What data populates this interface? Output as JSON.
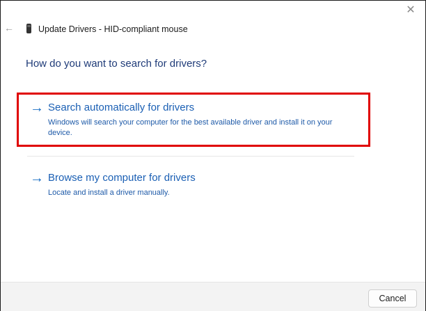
{
  "window": {
    "title": "Update Drivers - HID-compliant mouse",
    "close_glyph": "✕",
    "back_glyph": "←",
    "icons": [
      "close-icon",
      "back-arrow-icon",
      "mouse-device-icon"
    ]
  },
  "main": {
    "heading": "How do you want to search for drivers?",
    "options": [
      {
        "arrow": "→",
        "label": "Search automatically for drivers",
        "description": "Windows will search your computer for the best available driver and install it on your device.",
        "highlighted": true
      },
      {
        "arrow": "→",
        "label": "Browse my computer for drivers",
        "description": "Locate and install a driver manually.",
        "highlighted": false
      }
    ]
  },
  "footer": {
    "cancel_label": "Cancel"
  },
  "colors": {
    "accent_link": "#1a5fb4",
    "heading": "#1f3b78",
    "highlight_box": "#e00000",
    "footer_bg": "#f3f3f3"
  }
}
